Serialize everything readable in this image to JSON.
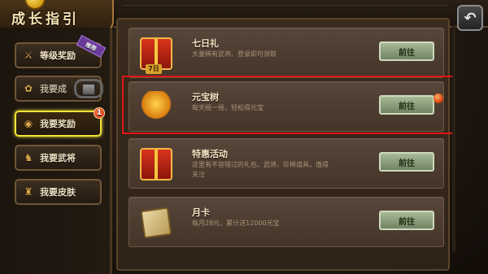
{
  "header": {
    "title": "成长指引",
    "back_icon": "back-arrow-icon"
  },
  "sidebar": {
    "items": [
      {
        "label": "等级奖励",
        "icon": "sword-icon",
        "badge": "推荐",
        "state": "normal"
      },
      {
        "label": "我要成",
        "icon": "tree-icon",
        "state": "locked"
      },
      {
        "label": "我要奖励",
        "icon": "coin-icon",
        "badge_count": "1",
        "state": "active"
      },
      {
        "label": "我要武将",
        "icon": "warrior-icon",
        "state": "normal"
      },
      {
        "label": "我要皮肤",
        "icon": "armor-icon",
        "state": "normal"
      }
    ]
  },
  "cards": [
    {
      "title": "七日礼",
      "desc": "大量稀有武将、登录即可领取",
      "icon": "gift-icon",
      "icon_label": "7日",
      "button": "前往"
    },
    {
      "title": "元宝树",
      "desc": "每天摇一摇，轻松得元宝",
      "icon": "money-tree-icon",
      "button": "前往",
      "has_red_dot": true,
      "highlighted": true
    },
    {
      "title": "特惠活动",
      "desc": "这里有不容错过的礼包，武将，珍稀道具，值得关注",
      "icon": "gift-box-icon",
      "button": "前往"
    },
    {
      "title": "月卡",
      "desc": "每月28元，累计送12000元宝",
      "icon": "month-card-icon",
      "button": "前往"
    }
  ],
  "colors": {
    "active_border": "#f2e233",
    "highlight_frame": "#e01515",
    "button_green": "#a7b996"
  }
}
